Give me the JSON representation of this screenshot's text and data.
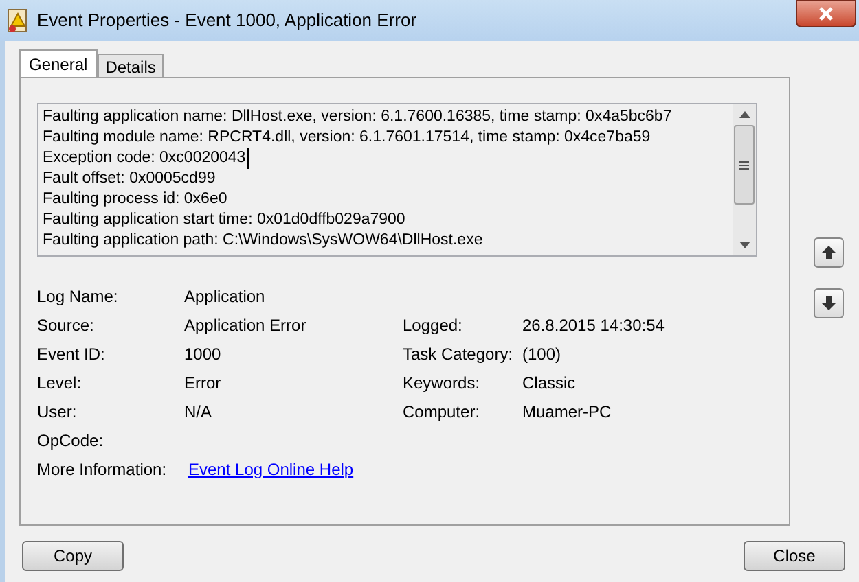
{
  "window": {
    "title": "Event Properties - Event 1000, Application Error"
  },
  "tabs": [
    {
      "label": "General",
      "selected": true
    },
    {
      "label": "Details",
      "selected": false
    }
  ],
  "description": {
    "lines": [
      {
        "text": "Faulting application name: DllHost.exe, version: 6.1.7600.16385, time stamp: 0x4a5bc6b7",
        "caret": false
      },
      {
        "text": "Faulting module name: RPCRT4.dll, version: 6.1.7601.17514, time stamp: 0x4ce7ba59",
        "caret": false
      },
      {
        "text": "Exception code: 0xc0020043",
        "caret": true
      },
      {
        "text": "Fault offset: 0x0005cd99",
        "caret": false
      },
      {
        "text": "Faulting process id: 0x6e0",
        "caret": false
      },
      {
        "text": "Faulting application start time: 0x01d0dffb029a7900",
        "caret": false
      },
      {
        "text": "Faulting application path: C:\\Windows\\SysWOW64\\DllHost.exe",
        "caret": false
      }
    ]
  },
  "rows": [
    {
      "left": {
        "label": "Log Name:",
        "value": "Application"
      }
    },
    {
      "left": {
        "label": "Source:",
        "value": "Application Error"
      },
      "right": {
        "label": "Logged:",
        "value": "26.8.2015 14:30:54"
      }
    },
    {
      "left": {
        "label": "Event ID:",
        "value": "1000"
      },
      "right": {
        "label": "Task Category:",
        "value": "(100)"
      }
    },
    {
      "left": {
        "label": "Level:",
        "value": "Error"
      },
      "right": {
        "label": "Keywords:",
        "value": "Classic"
      }
    },
    {
      "left": {
        "label": "User:",
        "value": "N/A"
      },
      "right": {
        "label": "Computer:",
        "value": "Muamer-PC"
      }
    },
    {
      "left": {
        "label": "OpCode:"
      }
    }
  ],
  "more_information": {
    "label": "More Information:",
    "link": "Event Log Online Help"
  },
  "buttons": [
    {
      "label": "Copy"
    },
    {
      "label": "Close"
    }
  ]
}
